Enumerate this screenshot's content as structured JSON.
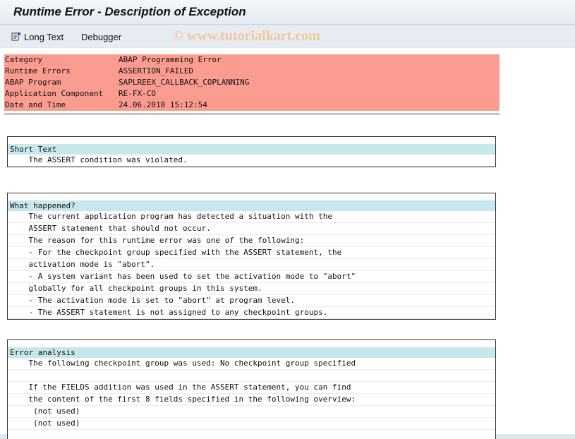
{
  "window": {
    "title": "Runtime Error - Description of Exception"
  },
  "toolbar": {
    "long_text_label": "Long Text",
    "debugger_label": "Debugger"
  },
  "watermark": "© www.tutorialkart.com",
  "header": [
    {
      "key": "Category",
      "value": "ABAP Programming Error"
    },
    {
      "key": "Runtime Errors",
      "value": "ASSERTION_FAILED"
    },
    {
      "key": "ABAP Program",
      "value": "SAPLREEX_CALLBACK_COPLANNING"
    },
    {
      "key": "Application Component",
      "value": "RE-FX-CO"
    },
    {
      "key": "Date and Time",
      "value": "24.06.2018 15:12:54"
    }
  ],
  "short_text": {
    "title": "Short Text",
    "lines": [
      "    The ASSERT condition was violated."
    ]
  },
  "what_happened": {
    "title": "What happened?",
    "lines": [
      "    The current application program has detected a situation with the",
      "    ASSERT statement that should not occur.",
      "    The reason for this runtime error was one of the following:",
      "    - For the checkpoint group specified with the ASSERT statement, the",
      "    activation mode is \"abort\".",
      "    - A system variant has been used to set the activation mode to \"abort\"",
      "    globally for all checkpoint groups in this system.",
      "    - The activation mode is set to \"abort\" at program level.",
      "    - The ASSERT statement is not assigned to any checkpoint groups."
    ]
  },
  "error_analysis": {
    "title": "Error analysis",
    "lines": [
      "    The following checkpoint group was used: No checkpoint group specified",
      "",
      "    If the FIELDS addition was used in the ASSERT statement, you can find",
      "    the content of the first 8 fields specified in the following overview:",
      "     (not used)",
      "     (not used)"
    ]
  }
}
